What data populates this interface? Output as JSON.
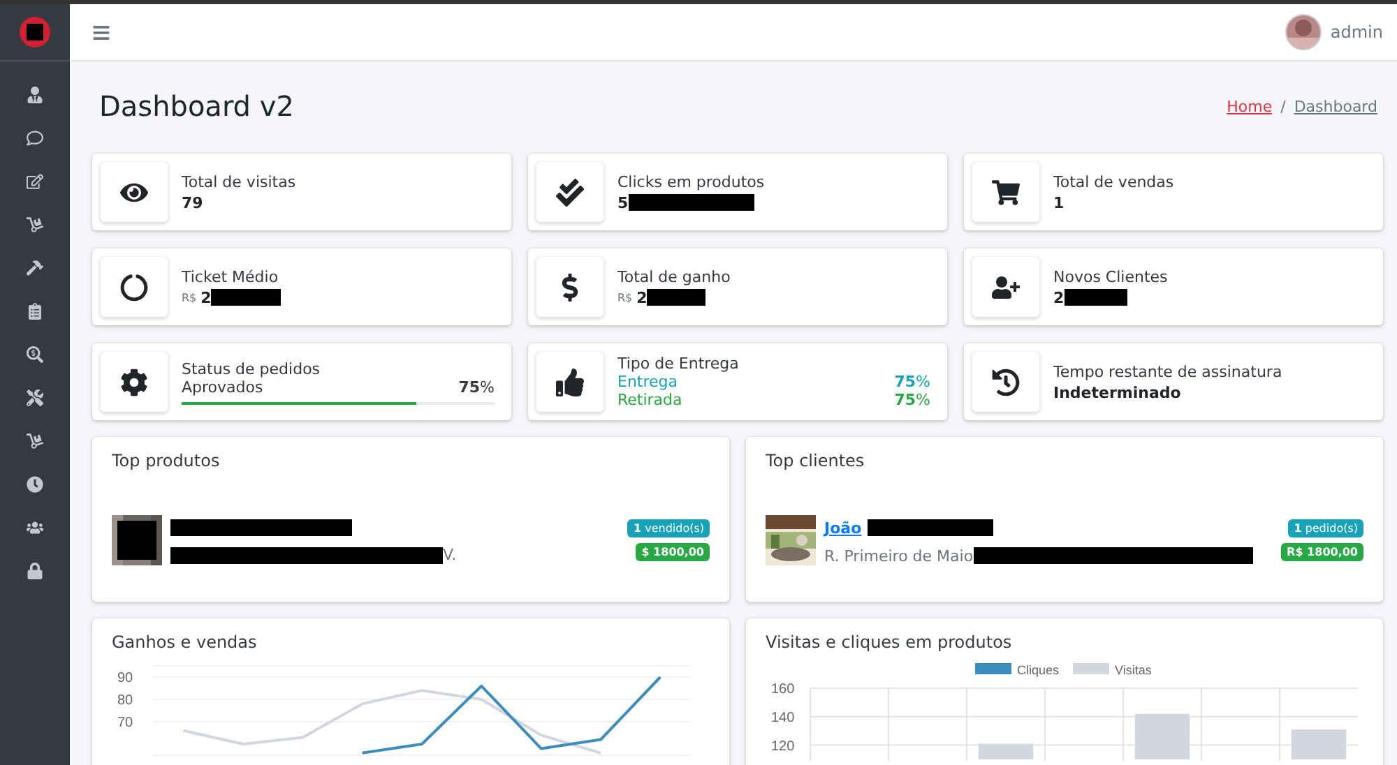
{
  "topbar": {
    "user": "admin"
  },
  "page": {
    "title": "Dashboard v2",
    "separator": "/",
    "breadcrumb": [
      {
        "label": "Home",
        "selected": false
      },
      {
        "label": "Dashboard",
        "selected": true
      }
    ]
  },
  "info_boxes": [
    {
      "kind": "value",
      "label": "Total de visitas",
      "value": "79",
      "redacted": false
    },
    {
      "kind": "value",
      "label": "Clicks em produtos",
      "value": "5",
      "redacted": true
    },
    {
      "kind": "value",
      "label": "Total de vendas",
      "value": "1",
      "redacted": false
    },
    {
      "kind": "money",
      "label": "Ticket Médio",
      "currency": "R$",
      "value": "2",
      "redacted": true
    },
    {
      "kind": "money",
      "label": "Total de ganho",
      "currency": "R$",
      "value": "2",
      "redacted": true
    },
    {
      "kind": "value",
      "label": "Novos Clientes",
      "value": "2",
      "redacted": true
    },
    {
      "kind": "progress",
      "label": "Status de pedidos",
      "item": "Aprovados",
      "reading": "**75**%",
      "level": 0.75
    },
    {
      "kind": "split",
      "label": "Tipo de Entrega",
      "rows": [
        {
          "name": "Entrega",
          "reading": "**75**%",
          "color": "#17a2b8"
        },
        {
          "name": "Retirada",
          "reading": "**75**%",
          "color": "#28a745"
        }
      ]
    },
    {
      "kind": "value",
      "label": "Tempo restante de assinatura",
      "value": "Indeterminado",
      "redacted": false
    }
  ],
  "top_products": {
    "title": "Top produtos",
    "items": [
      {
        "description": "V.",
        "count": "**1** vendido(s)",
        "amount": "$ 1800,00"
      }
    ]
  },
  "top_clients": {
    "title": "Top clientes",
    "items": [
      {
        "name": "João",
        "description": "R. Primeiro de Maio",
        "count": "**1** pedido(s)",
        "amount": "R$ 1800,00"
      }
    ]
  },
  "earnings_chart": {
    "title": "Ganhos e vendas",
    "chart_data": {
      "type": "line",
      "grid": true,
      "ylim": [
        55,
        95
      ],
      "yticks": [
        70,
        80,
        90
      ],
      "categories": [
        null,
        null,
        null,
        null,
        null,
        null,
        null,
        null,
        null
      ],
      "series": [
        {
          "color": "#d2d6de",
          "values": [
            66,
            60,
            63,
            78,
            84,
            80,
            64,
            56,
            null
          ]
        },
        {
          "color": "#3c8dbc",
          "values": [
            null,
            null,
            null,
            56,
            60,
            86,
            58,
            62,
            90
          ]
        }
      ]
    }
  },
  "visits_chart": {
    "title": "Visitas e cliques em produtos",
    "chart_data": {
      "type": "bar",
      "grid": true,
      "ylim": [
        110,
        160
      ],
      "yticks": [
        120,
        140,
        160
      ],
      "categories": [
        null,
        null,
        null,
        null,
        null,
        null,
        null
      ],
      "series": [
        {
          "name": "Cliques",
          "color": "#3c8dbc",
          "values": [
            null,
            null,
            null,
            null,
            null,
            null,
            null
          ]
        },
        {
          "name": "Visitas",
          "color": "#d2d6de",
          "values": [
            null,
            null,
            121,
            null,
            142,
            null,
            131
          ]
        }
      ]
    }
  }
}
